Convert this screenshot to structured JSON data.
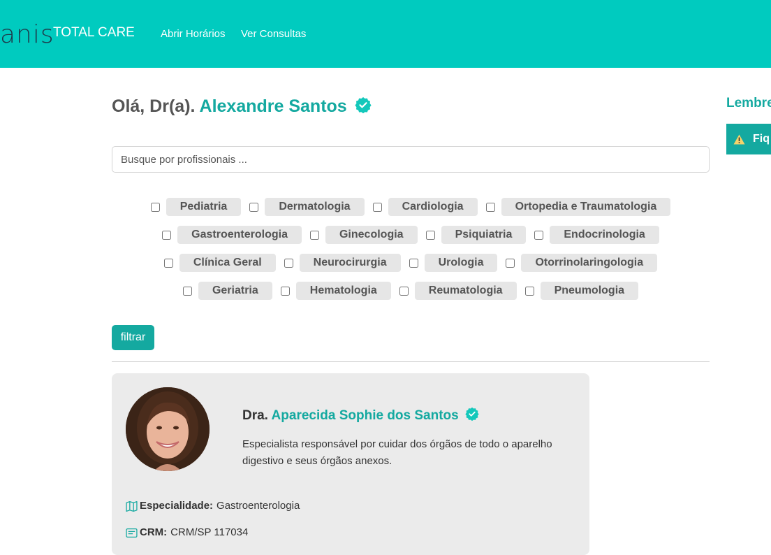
{
  "header": {
    "logo_text": "anis",
    "brand": "TOTAL CARE",
    "nav": [
      "Abrir Horários",
      "Ver Consultas"
    ]
  },
  "greeting": {
    "prefix": "Olá, Dr(a).",
    "name": "Alexandre Santos",
    "verified_icon": "verified-badge-icon"
  },
  "search": {
    "placeholder": "Busque por profissionais ..."
  },
  "specialties": [
    [
      "Pediatria",
      "Dermatologia",
      "Cardiologia",
      "Ortopedia e Traumatologia"
    ],
    [
      "Gastroenterologia",
      "Ginecologia",
      "Psiquiatria",
      "Endocrinologia"
    ],
    [
      "Clínica Geral",
      "Neurocirurgia",
      "Urologia",
      "Otorrinolaringologia"
    ],
    [
      "Geriatria",
      "Hematologia",
      "Reumatologia",
      "Pneumologia"
    ]
  ],
  "filter_button": "filtrar",
  "doctor_card": {
    "title_prefix": "Dra.",
    "name": "Aparecida Sophie dos Santos",
    "description": "Especialista responsável por cuidar dos órgãos de todo o aparelho digestivo e seus órgãos anexos.",
    "specialty_label": "Especialidade:",
    "specialty_value": "Gastroenterologia",
    "crm_label": "CRM:",
    "crm_value": "CRM/SP 117034"
  },
  "sidebar": {
    "title": "Lembre",
    "alert_text": "Fiq"
  },
  "colors": {
    "navbar": "#00cbbf",
    "accent": "#14a9a0",
    "tag_bg": "#e6e6e6",
    "card_bg": "#ebebeb"
  }
}
